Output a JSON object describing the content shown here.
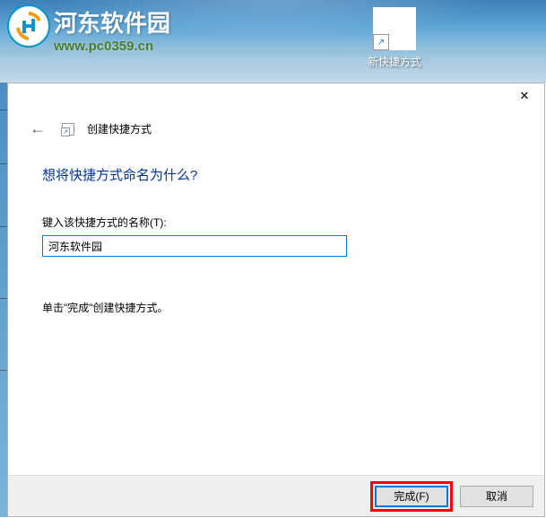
{
  "watermark": {
    "title": "河东软件园",
    "url": "www.pc0359.cn"
  },
  "desktop": {
    "shortcut_label": "新快捷方式"
  },
  "dialog": {
    "header_title": "创建快捷方式",
    "question": "想将快捷方式命名为什么?",
    "input_label": "键入该快捷方式的名称(T):",
    "input_value": "河东软件园",
    "hint": "单击\"完成\"创建快捷方式。",
    "finish_button": "完成(F)",
    "cancel_button": "取消",
    "close_icon": "✕"
  }
}
